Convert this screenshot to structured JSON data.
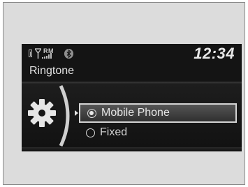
{
  "status": {
    "roaming": "RM",
    "time": "12:34"
  },
  "screen": {
    "title": "Ringtone"
  },
  "menu": {
    "options": [
      {
        "label": "Mobile Phone",
        "selected": true
      },
      {
        "label": "Fixed",
        "selected": false
      }
    ]
  },
  "icons": {
    "status": [
      "battery-icon",
      "antenna-icon",
      "signal-strength-icon",
      "bluetooth-icon"
    ],
    "menu": [
      "gear-icon"
    ]
  }
}
